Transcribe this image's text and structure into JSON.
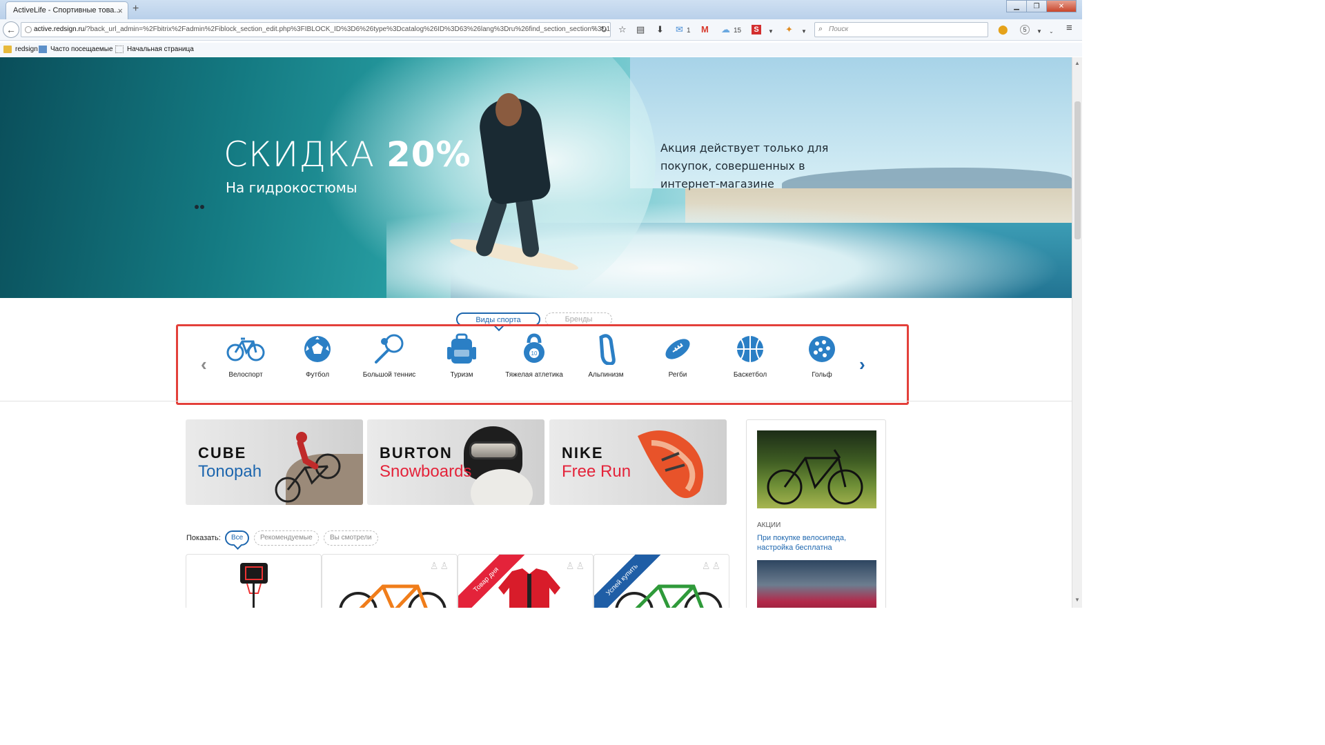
{
  "browser": {
    "tab_title": "ActiveLife - Спортивные това...",
    "tab_close": "×",
    "new_tab": "+",
    "url_host": "active.redsign.ru",
    "url_path": "/?back_url_admin=%2Fbitrix%2Fadmin%2Fiblock_section_edit.php%3FIBLOCK_ID%3D6%26type%3Dcatalog%26ID%3D63%26lang%3Dru%26find_section_section%3D1",
    "search_placeholder": "Поиск",
    "mail_count": "1",
    "weather_count": "15",
    "badge_count": "5",
    "bookmarks": [
      "redsign",
      "Часто посещаемые",
      "Начальная страница"
    ]
  },
  "hero": {
    "title_plain": "СКИДКА ",
    "title_bold": "20%",
    "subtitle": "На гидрокостюмы",
    "promo_text": "Акция действует только для покупок, совершенных в интернет-магазине"
  },
  "catalog_switch": {
    "active": "Виды спорта",
    "inactive": "Бренды"
  },
  "sports": [
    {
      "label": "Велоспорт",
      "icon": "bicycle-icon"
    },
    {
      "label": "Футбол",
      "icon": "soccer-ball-icon"
    },
    {
      "label": "Большой теннис",
      "icon": "tennis-racket-icon"
    },
    {
      "label": "Туризм",
      "icon": "backpack-icon"
    },
    {
      "label": "Тяжелая атлетика",
      "icon": "kettlebell-icon"
    },
    {
      "label": "Альпинизм",
      "icon": "carabiner-icon"
    },
    {
      "label": "Регби",
      "icon": "rugby-ball-icon"
    },
    {
      "label": "Баскетбол",
      "icon": "basketball-icon"
    },
    {
      "label": "Гольф",
      "icon": "golf-ball-icon"
    }
  ],
  "banners": [
    {
      "brand": "CUBE",
      "model": "Tonopah",
      "model_color": "#1d66ae"
    },
    {
      "brand": "BURTON",
      "model": "Snowboards",
      "model_color": "#e4233a"
    },
    {
      "brand": "NIKE",
      "model": "Free Run",
      "model_color": "#e4233a"
    }
  ],
  "sidebar": {
    "tag": "АКЦИИ",
    "link": "При покупке велосипеда, настройка бесплатна"
  },
  "filter": {
    "label": "Показать:",
    "options": [
      "Все",
      "Рекомендуемые",
      "Вы смотрели"
    ]
  },
  "products": {
    "ribbon_1": "Товар дня",
    "ribbon_2": "Успей купить"
  },
  "colors": {
    "accent": "#1d66ae",
    "highlight_frame": "#e3403a",
    "ribbon_red": "#e4233a",
    "ribbon_blue": "#1f5ea6"
  }
}
